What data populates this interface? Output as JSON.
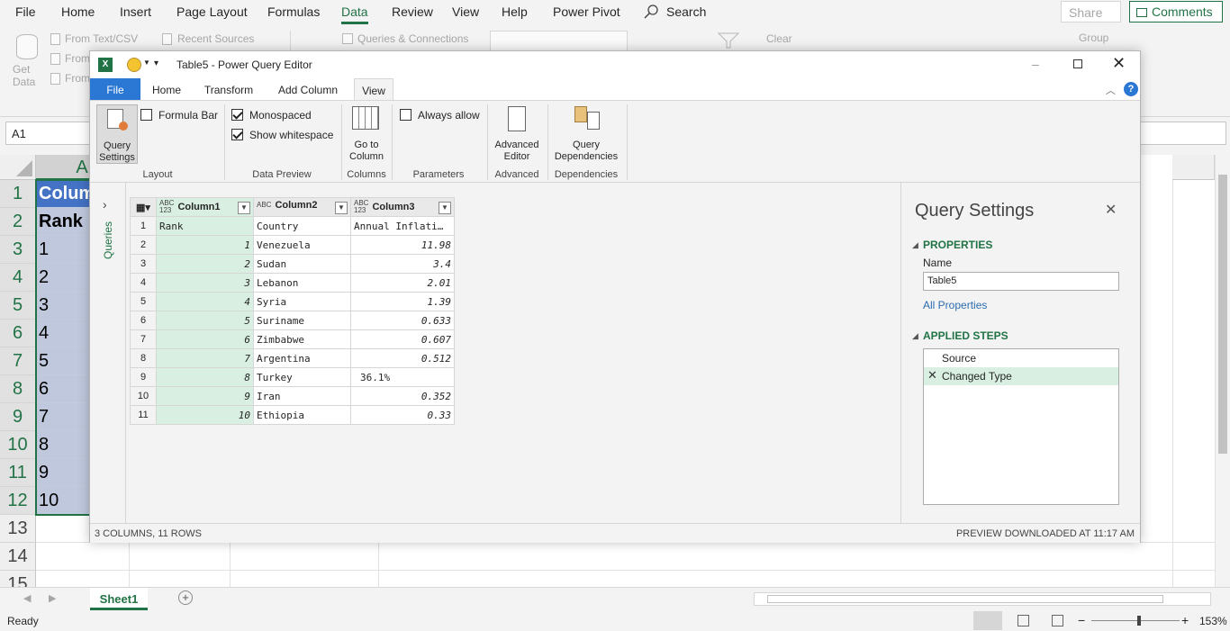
{
  "excel": {
    "menu": [
      "File",
      "Home",
      "Insert",
      "Page Layout",
      "Formulas",
      "Data",
      "Review",
      "View",
      "Help",
      "Power Pivot"
    ],
    "active_menu": "Data",
    "search_label": "Search",
    "share_label": "Share",
    "comments_label": "Comments",
    "ribbon": {
      "get_data": "Get\nData",
      "from_text_csv": "From Text/CSV",
      "from_web": "From",
      "from_table": "From",
      "recent_sources": "Recent Sources",
      "queries_connections": "Queries & Connections",
      "clear": "Clear",
      "group": "Group"
    },
    "name_box": "A1",
    "col_a": "A",
    "row_numbers": [
      "1",
      "2",
      "3",
      "4",
      "5",
      "6",
      "7",
      "8",
      "9",
      "10",
      "11",
      "12",
      "13",
      "14",
      "15"
    ],
    "col_a_values": [
      "Colum",
      "Rank",
      "1",
      "2",
      "3",
      "4",
      "5",
      "6",
      "7",
      "8",
      "9",
      "10"
    ],
    "sheet_tab": "Sheet1",
    "status": "Ready",
    "zoom": "153%"
  },
  "pq": {
    "title": "Table5 - Power Query Editor",
    "tabs": [
      "File",
      "Home",
      "Transform",
      "Add Column",
      "View"
    ],
    "active_tab": "View",
    "ribbon": {
      "query_settings": "Query\nSettings",
      "formula_bar": "Formula Bar",
      "formula_bar_checked": false,
      "layout_group": "Layout",
      "monospaced": "Monospaced",
      "monospaced_checked": true,
      "show_whitespace": "Show whitespace",
      "show_whitespace_checked": true,
      "data_preview_group": "Data Preview",
      "go_to_column": "Go to\nColumn",
      "columns_group": "Columns",
      "always_allow": "Always allow",
      "always_allow_checked": false,
      "parameters_group": "Parameters",
      "advanced_editor": "Advanced\nEditor",
      "advanced_group": "Advanced",
      "query_dependencies": "Query\nDependencies",
      "dependencies_group": "Dependencies"
    },
    "queries_label": "Queries",
    "table": {
      "headers": [
        {
          "type": "ABC\n123",
          "name": "Column1"
        },
        {
          "type": "ABC",
          "name": "Column2"
        },
        {
          "type": "ABC\n123",
          "name": "Column3"
        }
      ],
      "rows": [
        {
          "n": "1",
          "c1": "Rank",
          "c2": "Country",
          "c3": "Annual Inflati…"
        },
        {
          "n": "2",
          "c1": "1",
          "c2": "Venezuela",
          "c3": "11.98"
        },
        {
          "n": "3",
          "c1": "2",
          "c2": "Sudan",
          "c3": "3.4"
        },
        {
          "n": "4",
          "c1": "3",
          "c2": "Lebanon",
          "c3": "2.01"
        },
        {
          "n": "5",
          "c1": "4",
          "c2": "Syria",
          "c3": "1.39"
        },
        {
          "n": "6",
          "c1": "5",
          "c2": "Suriname",
          "c3": "0.633"
        },
        {
          "n": "7",
          "c1": "6",
          "c2": "Zimbabwe",
          "c3": "0.607"
        },
        {
          "n": "8",
          "c1": "7",
          "c2": "Argentina",
          "c3": "0.512"
        },
        {
          "n": "9",
          "c1": "8",
          "c2": "Turkey",
          "c3": "36.1%"
        },
        {
          "n": "10",
          "c1": "9",
          "c2": "Iran",
          "c3": "0.352"
        },
        {
          "n": "11",
          "c1": "10",
          "c2": "Ethiopia",
          "c3": "0.33"
        }
      ]
    },
    "settings": {
      "title": "Query Settings",
      "properties_header": "PROPERTIES",
      "name_label": "Name",
      "name_value": "Table5",
      "all_properties": "All Properties",
      "applied_steps_header": "APPLIED STEPS",
      "steps": [
        "Source",
        "Changed Type"
      ],
      "selected_step": "Changed Type"
    },
    "status_left": "3 COLUMNS, 11 ROWS",
    "status_right": "PREVIEW DOWNLOADED AT 11:17 AM"
  },
  "colors": {
    "excel_green": "#217346",
    "pq_file_blue": "#2b78d4",
    "selected_column_green": "#d8efe2",
    "cell_selection_blue": "#bfc8dd"
  }
}
